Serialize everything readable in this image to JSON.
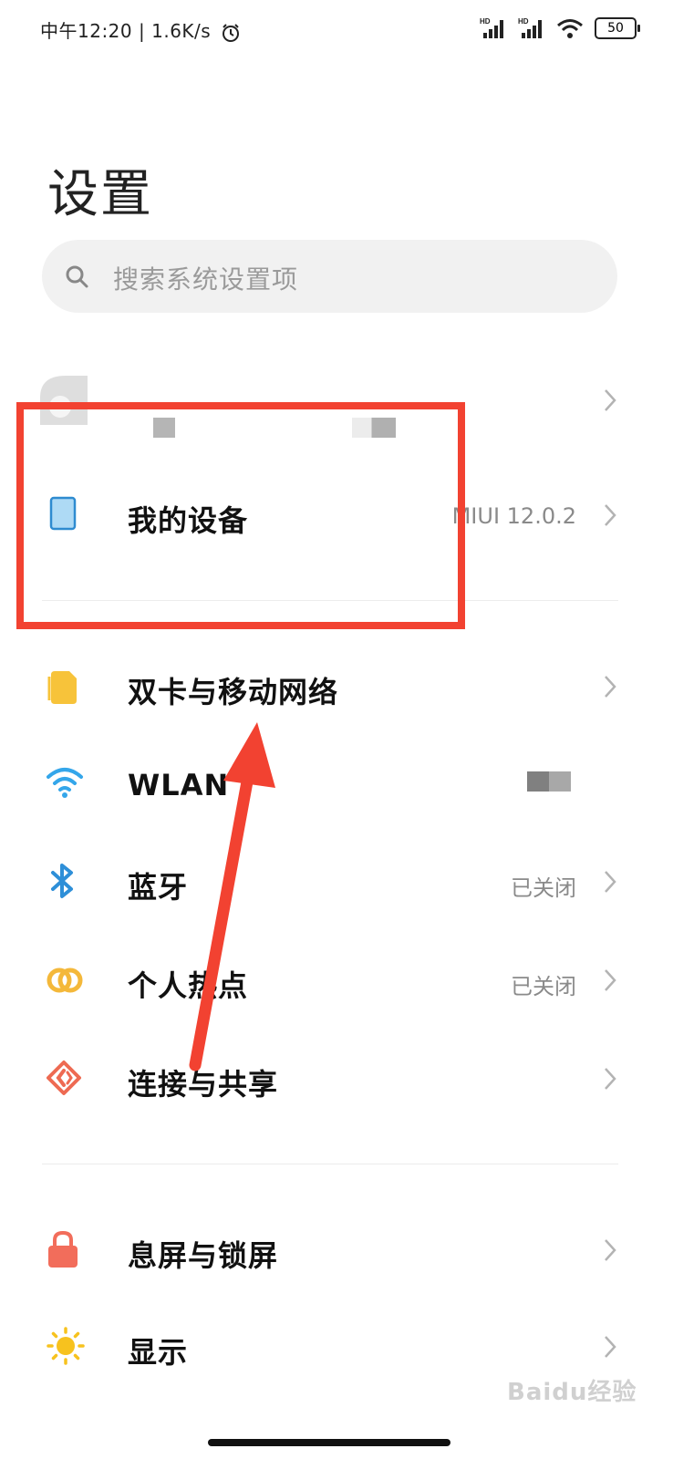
{
  "status_bar": {
    "time": "中午12:20",
    "speed": "1.6K/s",
    "battery": "50"
  },
  "page": {
    "title": "设置"
  },
  "search": {
    "placeholder": "搜索系统设置项"
  },
  "settings": {
    "my_device": {
      "label": "我的设备",
      "value": "MIUI 12.0.2"
    },
    "dual_sim": {
      "label": "双卡与移动网络"
    },
    "wlan": {
      "label": "WLAN"
    },
    "bluetooth": {
      "label": "蓝牙",
      "value": "已关闭"
    },
    "hotspot": {
      "label": "个人热点",
      "value": "已关闭"
    },
    "connection": {
      "label": "连接与共享"
    },
    "lock_screen": {
      "label": "息屏与锁屏"
    },
    "display": {
      "label": "显示"
    }
  },
  "watermark": {
    "text": "Baidu经验"
  },
  "colors": {
    "annotation_red": "#f24231",
    "sim_icon": "#f7c33a",
    "wlan_icon": "#34a6ea",
    "hotspot_icon": "#f4b83a",
    "share_icon": "#ee6a52",
    "lock_icon": "#f26d5b",
    "display_icon": "#f7c21e"
  }
}
